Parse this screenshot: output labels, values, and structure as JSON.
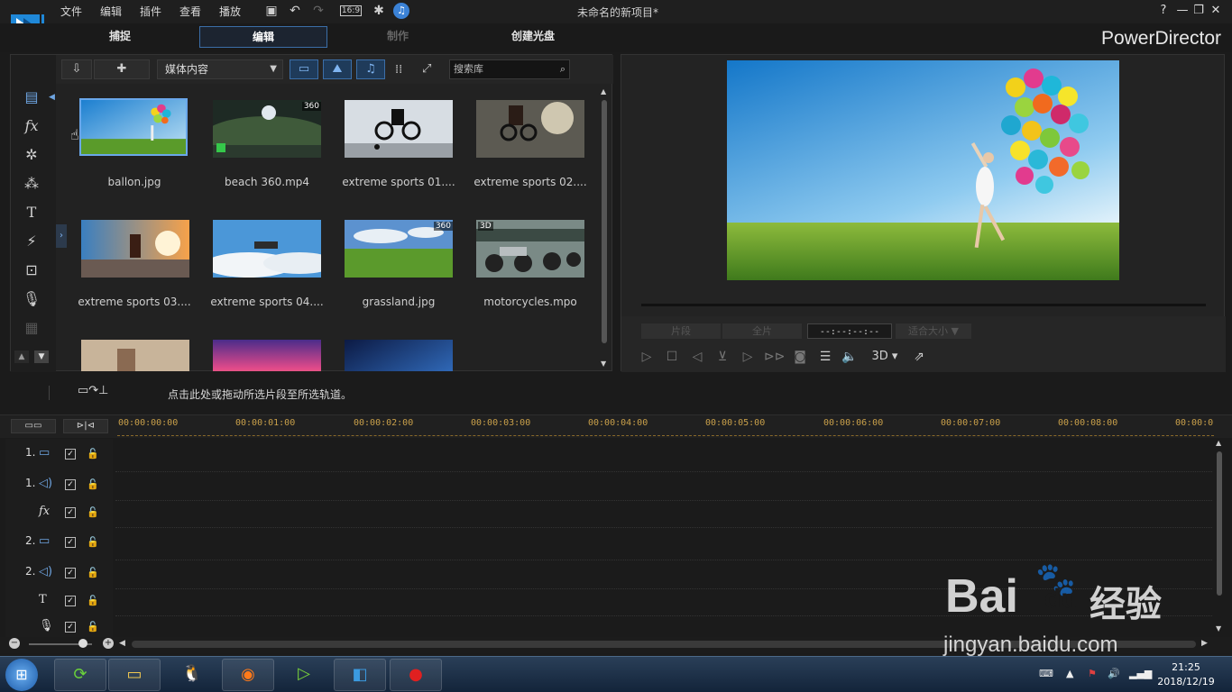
{
  "menu": {
    "items": [
      "文件",
      "编辑",
      "插件",
      "查看",
      "播放"
    ],
    "aspect": "16:9"
  },
  "window": {
    "title": "未命名的新项目*",
    "help": "?",
    "brand": "PowerDirector"
  },
  "modes": {
    "capture": "捕捉",
    "edit": "编辑",
    "produce": "制作",
    "disc": "创建光盘"
  },
  "library": {
    "content_type": "媒体内容",
    "search_placeholder": "搜索库",
    "items": [
      {
        "label": "ballon.jpg",
        "badge": ""
      },
      {
        "label": "beach 360.mp4",
        "badge": "360"
      },
      {
        "label": "extreme sports 01....",
        "badge": ""
      },
      {
        "label": "extreme sports 02....",
        "badge": ""
      },
      {
        "label": "extreme sports 03....",
        "badge": ""
      },
      {
        "label": "extreme sports 04....",
        "badge": ""
      },
      {
        "label": "grassland.jpg",
        "badge": "360"
      },
      {
        "label": "motorcycles.mpo",
        "badge": "3D"
      }
    ]
  },
  "preview": {
    "clip_label": "片段",
    "movie_label": "全片",
    "timecode": "--:--:--:--",
    "fit_label": "适合大小",
    "mode_3d": "3D"
  },
  "hint": {
    "text": "点击此处或拖动所选片段至所选轨道。"
  },
  "timeline": {
    "ticks": [
      "00:00:00:00",
      "00:00:01:00",
      "00:00:02:00",
      "00:00:03:00",
      "00:00:04:00",
      "00:00:05:00",
      "00:00:06:00",
      "00:00:07:00",
      "00:00:08:00",
      "00:00:0"
    ],
    "tracks": [
      {
        "num": "1.",
        "icon": "video-track-icon"
      },
      {
        "num": "1.",
        "icon": "audio-track-icon"
      },
      {
        "num": "",
        "icon": "fx-track-icon"
      },
      {
        "num": "2.",
        "icon": "video-track-icon"
      },
      {
        "num": "2.",
        "icon": "audio-track-icon"
      },
      {
        "num": "",
        "icon": "title-track-icon"
      },
      {
        "num": "",
        "icon": "voice-track-icon"
      }
    ]
  },
  "taskbar": {
    "time": "21:25",
    "date": "2018/12/19"
  },
  "watermark": {
    "brand": "Bai",
    "brand2": "du",
    "cn": "经验",
    "url": "jingyan.baidu.com"
  },
  "colors": {
    "accent": "#3b6ea8",
    "timecode": "#c9a04a",
    "background": "#1b1b1b"
  }
}
